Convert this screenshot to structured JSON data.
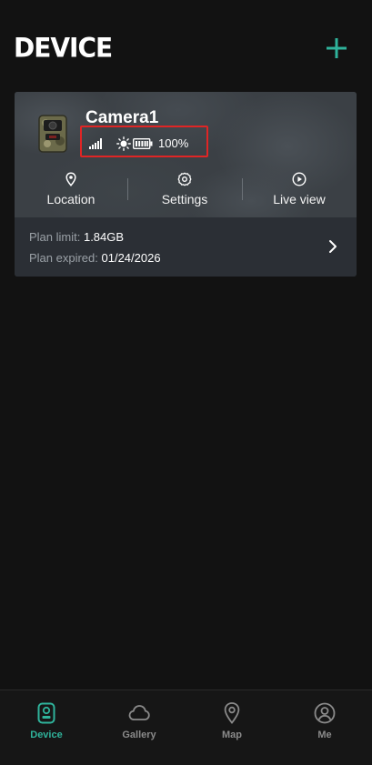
{
  "header": {
    "title": "DEVICE",
    "add_icon": "plus-icon"
  },
  "device": {
    "name": "Camera1",
    "battery_percent": "100%",
    "signal_icon": "signal-bars-icon",
    "daylight_icon": "sun-icon",
    "battery_icon": "battery-icon",
    "actions": [
      {
        "label": "Location",
        "icon": "map-pin-icon"
      },
      {
        "label": "Settings",
        "icon": "gear-icon"
      },
      {
        "label": "Live view",
        "icon": "play-circle-icon"
      }
    ],
    "plan": {
      "limit_label": "Plan limit: ",
      "limit_value": "1.84GB",
      "expired_label": "Plan expired: ",
      "expired_value": "01/24/2026"
    }
  },
  "tabbar": {
    "tabs": [
      {
        "label": "Device",
        "icon": "device-icon",
        "active": true
      },
      {
        "label": "Gallery",
        "icon": "cloud-icon",
        "active": false
      },
      {
        "label": "Map",
        "icon": "map-pin-icon",
        "active": false
      },
      {
        "label": "Me",
        "icon": "user-icon",
        "active": false
      }
    ]
  },
  "colors": {
    "accent": "#2fb39b",
    "background": "#121212",
    "highlight_box": "#e02525"
  }
}
